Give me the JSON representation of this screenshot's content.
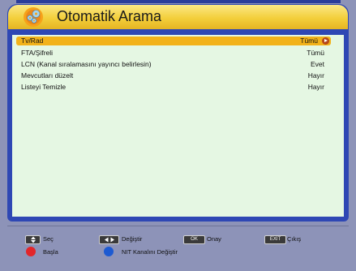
{
  "header": {
    "title": "Otomatik Arama",
    "icon": "gear-globe-icon"
  },
  "settings": [
    {
      "label": "Tv/Rad",
      "value": "Tümü",
      "selected": true
    },
    {
      "label": "FTA/Şifreli",
      "value": "Tümü"
    },
    {
      "label": "LCN (Kanal sıralamasını yayıncı belirlesin)",
      "value": "Evet"
    },
    {
      "label": "Mevcutları düzelt",
      "value": "Hayır"
    },
    {
      "label": "Listeyi Temizle",
      "value": "Hayır"
    }
  ],
  "help": {
    "select_label": "Seç",
    "change_label": "Değiştir",
    "ok_key": "OK",
    "ok_label": "Onay",
    "exit_key": "EXIT",
    "exit_label": "Çıkış",
    "red_label": "Başla",
    "blue_label": "NIT Kanalını Değiştir"
  },
  "colors": {
    "frame": "#2e47b4",
    "content_bg": "#e5f7e3",
    "highlight": "#f2b21a",
    "red": "#e3262a",
    "blue": "#1d5ad1"
  }
}
